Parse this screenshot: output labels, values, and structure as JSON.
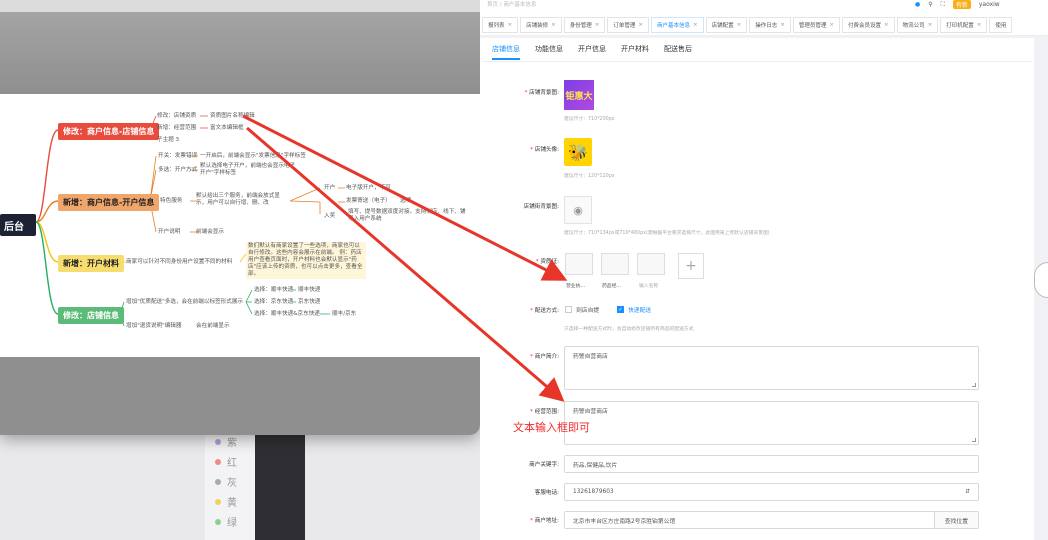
{
  "mindmap": {
    "root": "后台",
    "branches": [
      {
        "label": "修改：商户信息-店铺信息",
        "color": "#e74c3c"
      },
      {
        "label": "新增：商户信息-开户信息",
        "color": "#e67e22"
      },
      {
        "label": "新增：开户材料",
        "color": "#f1c40f"
      },
      {
        "label": "修改：店铺信息",
        "color": "#27ae60"
      }
    ],
    "b1": [
      "修改：店铺资质",
      "新增：经营范围",
      "子主题 3",
      "资质图片名称编辑",
      "富文本编辑框"
    ],
    "b2": [
      "开关：发票错误",
      "一开启后，前端会显示\"发票信息\"字样标签",
      "多选：开户方式",
      "默认选择电子开户，前端也会显示电子开户\"字样标签",
      "特色服务",
      "默认给出三个服务，前端会放式显示，用户可以自行增、删、改",
      "开户",
      "电子版开户，不可",
      "发票寄送（电子）",
      "选项",
      "入奖",
      "填写、提号数据双度对接，支持到店、线下、铺导入用户系统",
      "开户说明",
      "前端会显示"
    ],
    "b3": [
      "商家可以针对不同身份用户设置不同的材料",
      "数们默认有商家设置了一些选项，商家也可以自行修改。这些内容会展示在前端。",
      "例：药店用户查看页面时，开户材料也会默认显示\"药店\"应该上传的资质，也可以点击更多，查看全部。"
    ],
    "b4": [
      "增加\"优质配送\"多选，会在前端以标签形式展示",
      "选择：顺丰快递",
      "顺丰快递",
      "选择：京东快递",
      "京东快递",
      "选择：顺丰快递&京东快递",
      "顺丰/京东",
      "增加\"退货说明\"编辑器",
      "会在前端显示"
    ]
  },
  "bg_list": [
    "紫",
    "红",
    "灰",
    "黄",
    "绿"
  ],
  "breadcrumb": "首页 / 商户基本信息",
  "header": {
    "user": "yaoxiw",
    "badge": "有新"
  },
  "tabs": [
    "报列表",
    "店铺装修",
    "身份管理",
    "订单管理",
    "商户基本信息",
    "店铺配置",
    "操作日志",
    "管理员管理",
    "付费会员设置",
    "物流公司",
    "打印机配置",
    "使用"
  ],
  "active_tab": "商户基本信息",
  "subtabs": [
    "店铺信息",
    "功能信息",
    "开户信息",
    "开户材料",
    "配送售后"
  ],
  "active_subtab": "店铺信息",
  "form": {
    "store_bg_label": "店铺背景图:",
    "store_bg_hint": "建议尺寸：710*200px",
    "store_bg_text": "钜惠大",
    "avatar_label": "店铺头像:",
    "avatar_hint": "建议尺寸：120*120px",
    "notice_bg_label": "店铺街背景图:",
    "notice_bg_hint": "建议尺寸：710*134px或710*480px(需根据平台要求选择尺寸，此图用来上传默认店铺背景图)",
    "qual_label": "资质证:",
    "qual_captions": [
      "营业执...",
      "药品经...",
      "输入名称"
    ],
    "delivery_label": "配送方式:",
    "delivery_options": [
      "到店自提",
      "快递配送"
    ],
    "delivery_hint": "只选择一种配送方式时，会自动修改店铺所有商品的配送方式",
    "intro_label": "商户简介:",
    "intro_value": "药警自营商店",
    "scope_label": "经营范围:",
    "scope_value": "药警自营商店",
    "keywords_label": "商户关键字:",
    "keywords_value": "药品,保健品,饮片",
    "phone_label": "客服电话:",
    "phone_value": "13261879603",
    "address_label": "商户地址:",
    "address_value": "北京市丰台区方庄南路2号京胜铂第公馆",
    "find_location": "查找位置"
  },
  "annotation": "文本输入框即可",
  "colors": {
    "accent": "#1890ff",
    "required": "#f5222d",
    "arrow": "#e8352a"
  }
}
